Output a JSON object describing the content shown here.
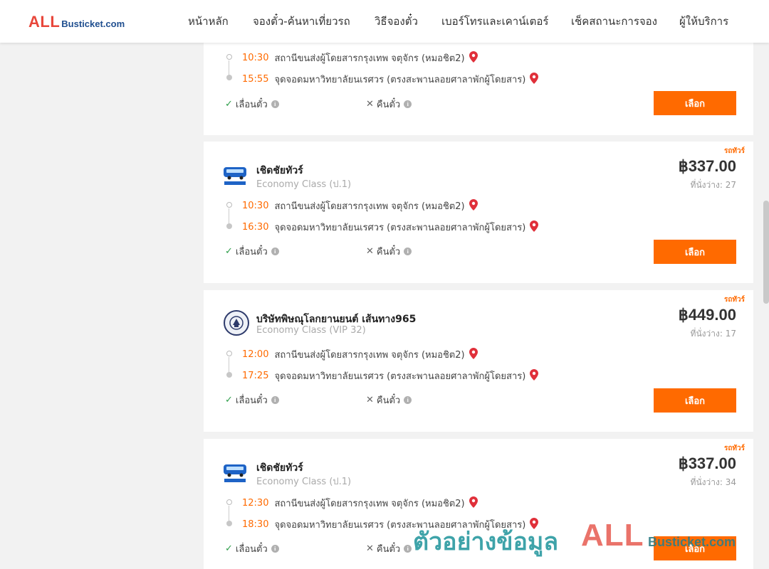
{
  "brand": {
    "logo_main": "ALL",
    "logo_sub": "Busticket.com"
  },
  "nav": {
    "home": "หน้าหลัก",
    "booking": "จองตั๋ว-ค้นหาเที่ยวรถ",
    "how_to": "วิธีจองตั๋ว",
    "contacts": "เบอร์โทรและเคาน์เตอร์",
    "check_status": "เช็คสถานะการจอง",
    "providers": "ผู้ให้บริการ"
  },
  "labels": {
    "badge": "รถทัวร์",
    "postpone": "เลื่อนตั๋ว",
    "refund": "คืนตั๋ว",
    "select": "เลือก",
    "seats_prefix": "ที่นั่งว่าง:"
  },
  "cards": [
    {
      "depart_time": "10:30",
      "depart_place": "สถานีขนส่งผู้โดยสารกรุงเทพ จตุจักร (หมอชิต2)",
      "arrive_time": "15:55",
      "arrive_place": "จุดจอดมหาวิทยาลัยนเรศวร (ตรงสะพานลอยศาลาพักผู้โดยสาร)"
    },
    {
      "operator": "เชิดชัยทัวร์",
      "class": "Economy Class (ป.1)",
      "price": "฿337.00",
      "seats": "27",
      "depart_time": "10:30",
      "depart_place": "สถานีขนส่งผู้โดยสารกรุงเทพ จตุจักร (หมอชิต2)",
      "arrive_time": "16:30",
      "arrive_place": "จุดจอดมหาวิทยาลัยนเรศวร (ตรงสะพานลอยศาลาพักผู้โดยสาร)"
    },
    {
      "operator": "บริษัทพิษณุโลกยานยนต์ เส้นทาง965",
      "class": "Economy Class (VIP 32)",
      "price": "฿449.00",
      "seats": "17",
      "depart_time": "12:00",
      "depart_place": "สถานีขนส่งผู้โดยสารกรุงเทพ จตุจักร (หมอชิต2)",
      "arrive_time": "17:25",
      "arrive_place": "จุดจอดมหาวิทยาลัยนเรศวร (ตรงสะพานลอยศาลาพักผู้โดยสาร)"
    },
    {
      "operator": "เชิดชัยทัวร์",
      "class": "Economy Class (ป.1)",
      "price": "฿337.00",
      "seats": "34",
      "depart_time": "12:30",
      "depart_place": "สถานีขนส่งผู้โดยสารกรุงเทพ จตุจักร (หมอชิต2)",
      "arrive_time": "18:30",
      "arrive_place": "จุดจอดมหาวิทยาลัยนเรศวร (ตรงสะพานลอยศาลาพักผู้โดยสาร)"
    }
  ],
  "watermark": {
    "text": "ตัวอย่างข้อมูล",
    "brand_main": "ALL",
    "brand_sub": "Busticket.com"
  },
  "colors": {
    "accent": "#ff6a00",
    "logo_red": "#e8473b",
    "logo_blue": "#1f4e8f",
    "check": "#2e9e4a",
    "pin": "#e0303a"
  }
}
